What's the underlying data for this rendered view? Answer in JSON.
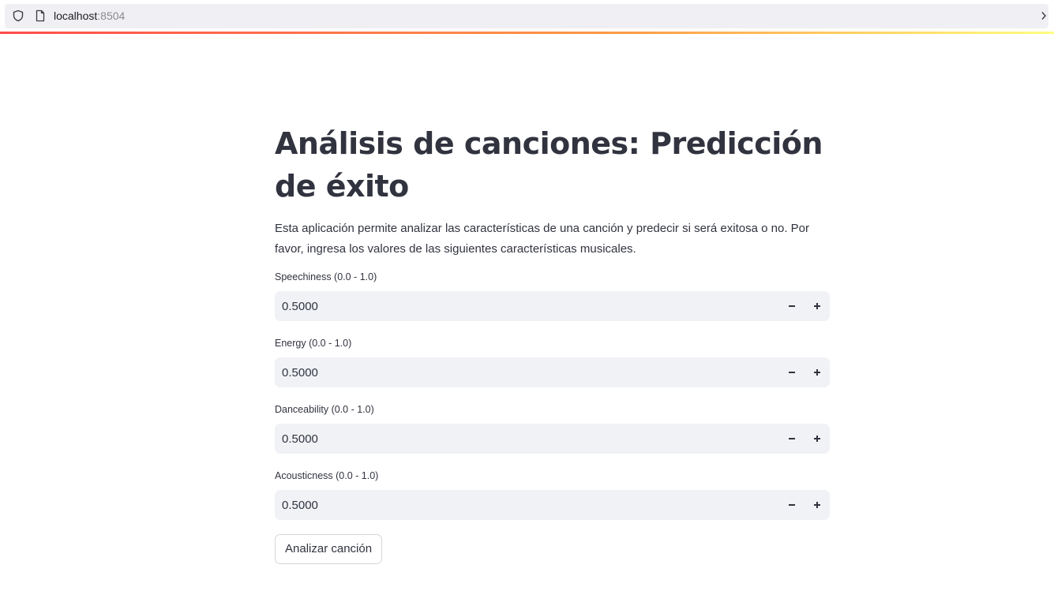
{
  "browser": {
    "url_host": "localhost",
    "url_port": ":8504"
  },
  "page": {
    "title": "Análisis de canciones: Predicción de éxito",
    "intro": "Esta aplicación permite analizar las características de una canción y predecir si será exitosa o no. Por favor, ingresa los valores de las siguientes características musicales."
  },
  "fields": [
    {
      "label": "Speechiness (0.0 - 1.0)",
      "value": "0.5000"
    },
    {
      "label": "Energy (0.0 - 1.0)",
      "value": "0.5000"
    },
    {
      "label": "Danceability (0.0 - 1.0)",
      "value": "0.5000"
    },
    {
      "label": "Acousticness (0.0 - 1.0)",
      "value": "0.5000"
    }
  ],
  "actions": {
    "analyze_label": "Analizar canción"
  },
  "icons": {
    "shield": "shield-icon",
    "page": "page-icon",
    "minus": "minus-icon",
    "plus": "plus-icon"
  },
  "colors": {
    "accent_gradient": [
      "#ff4b4b",
      "#ffbd45",
      "#fffd80"
    ],
    "input_background": "#f0f2f6",
    "text": "#31333f"
  }
}
